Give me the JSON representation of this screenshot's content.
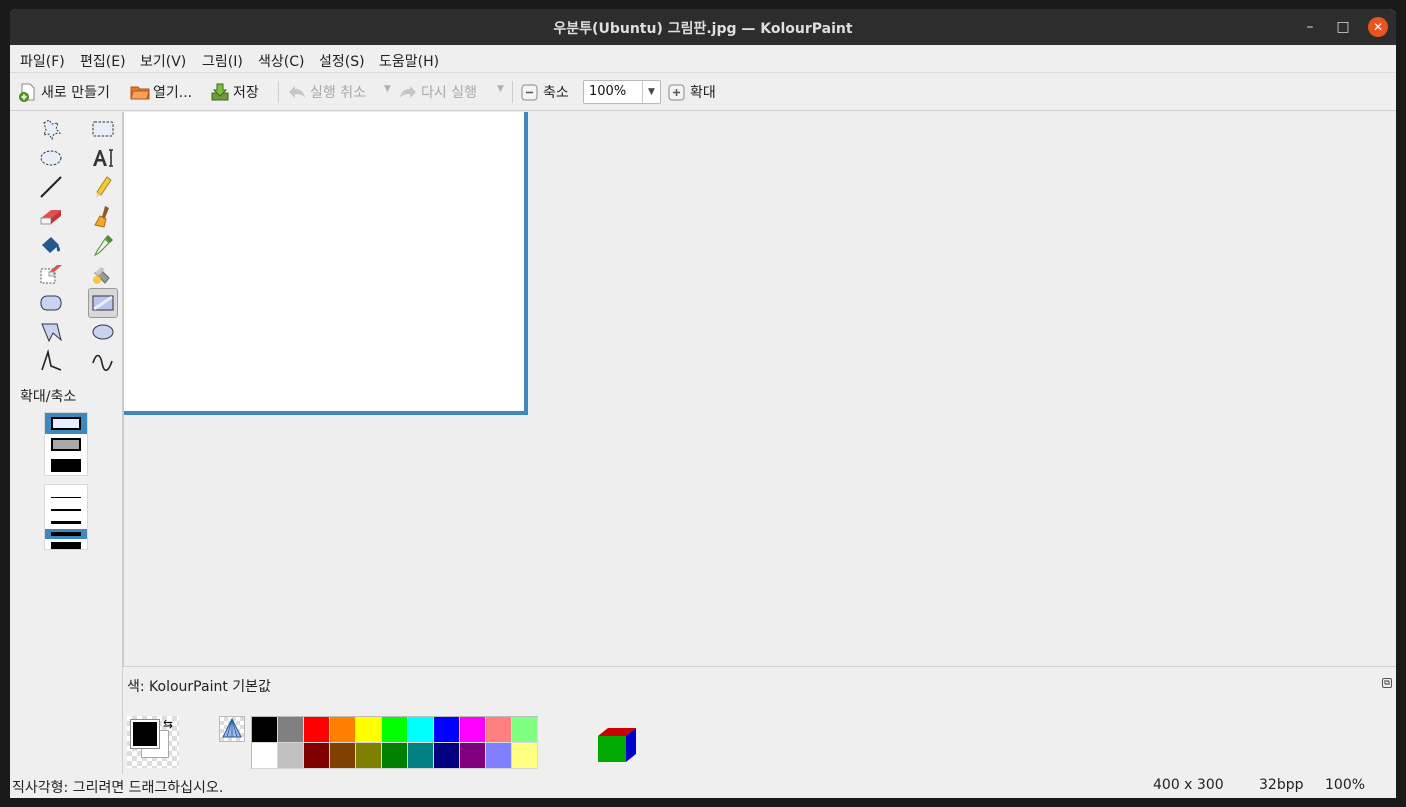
{
  "window": {
    "title": "우분투(Ubuntu) 그림판.jpg  — KolourPaint",
    "min_glyph": "–",
    "max_glyph": "□",
    "close_glyph": "✕"
  },
  "menu": [
    {
      "label": "파일(F)"
    },
    {
      "label": "편집(E)"
    },
    {
      "label": "보기(V)"
    },
    {
      "label": "그림(I)"
    },
    {
      "label": "색상(C)"
    },
    {
      "label": "설정(S)"
    },
    {
      "label": "도움말(H)"
    }
  ],
  "toolbar": {
    "new_label": "새로 만들기",
    "open_label": "열기...",
    "save_label": "저장",
    "undo_label": "실행 취소",
    "redo_label": "다시 실행",
    "zoom_out_label": "축소",
    "zoom_value": "100%",
    "zoom_in_label": "확대"
  },
  "tools": [
    {
      "name": "free-form-selection-icon"
    },
    {
      "name": "rectangular-selection-icon"
    },
    {
      "name": "elliptical-selection-icon"
    },
    {
      "name": "text-tool-icon"
    },
    {
      "name": "line-tool-icon"
    },
    {
      "name": "pen-tool-icon"
    },
    {
      "name": "eraser-tool-icon"
    },
    {
      "name": "brush-tool-icon"
    },
    {
      "name": "flood-fill-tool-icon"
    },
    {
      "name": "color-picker-tool-icon"
    },
    {
      "name": "color-eraser-tool-icon"
    },
    {
      "name": "spraycan-tool-icon"
    },
    {
      "name": "rounded-rectangle-tool-icon"
    },
    {
      "name": "rectangle-tool-icon",
      "active": true
    },
    {
      "name": "polygon-tool-icon"
    },
    {
      "name": "ellipse-tool-icon"
    },
    {
      "name": "connected-lines-tool-icon"
    },
    {
      "name": "curve-tool-icon"
    }
  ],
  "sidebar": {
    "zoom_label": "확대/축소"
  },
  "palette": {
    "title": "색: KolourPaint 기본값",
    "foreground": "#000000",
    "background": "#ffffff",
    "row1": [
      "#000000",
      "#808080",
      "#ff0000",
      "#ff8000",
      "#ffff00",
      "#00ff00",
      "#00ffff",
      "#0000ff",
      "#ff00ff",
      "#ff8080",
      "#80ff80"
    ],
    "row2": [
      "#ffffff",
      "#c0c0c0",
      "#800000",
      "#804000",
      "#808000",
      "#008000",
      "#008080",
      "#000080",
      "#800080",
      "#8080ff",
      "#ffff80"
    ]
  },
  "status": {
    "message": "직사각형: 그리려면 드래그하십시오.",
    "dimensions": "400 x 300",
    "depth": "32bpp",
    "zoom": "100%"
  }
}
